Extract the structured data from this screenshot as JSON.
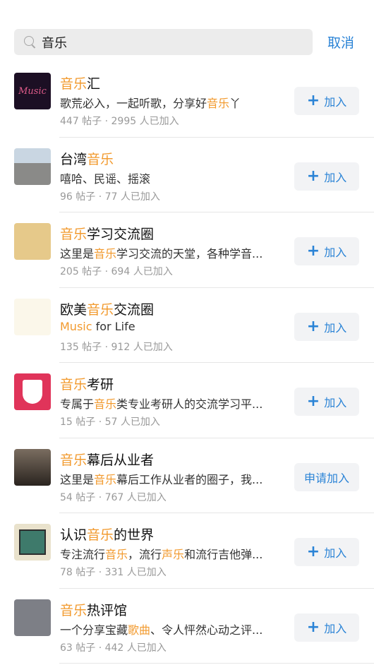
{
  "search": {
    "value": "音乐",
    "placeholder": ""
  },
  "cancel_label": "取消",
  "join_plus": "+",
  "items": [
    {
      "title": [
        [
          "音乐",
          true
        ],
        [
          "汇",
          false
        ]
      ],
      "desc": [
        [
          "歌荒必入，一起听歌，分享好",
          false
        ],
        [
          "音乐",
          true
        ],
        [
          "丫",
          false
        ]
      ],
      "meta": "447 帖子 · 2995 人已加入",
      "button": "加入",
      "thumb_text": "Music"
    },
    {
      "title": [
        [
          "台湾",
          false
        ],
        [
          "音乐",
          true
        ]
      ],
      "desc": [
        [
          "嘻哈、民谣、摇滚",
          false
        ]
      ],
      "meta": "96 帖子 · 77 人已加入",
      "button": "加入"
    },
    {
      "title": [
        [
          "音乐",
          true
        ],
        [
          "学习交流圈",
          false
        ]
      ],
      "desc": [
        [
          "这里是",
          false
        ],
        [
          "音乐",
          true
        ],
        [
          "学习交流的天堂，各种学音...",
          false
        ]
      ],
      "meta": "205 帖子 · 694 人已加入",
      "button": "加入"
    },
    {
      "title": [
        [
          "欧美",
          false
        ],
        [
          "音乐",
          true
        ],
        [
          "交流圈",
          false
        ]
      ],
      "desc": [
        [
          "Music",
          true
        ],
        [
          " for Life",
          false
        ]
      ],
      "meta": "135 帖子 · 912 人已加入",
      "button": "加入",
      "thumb_text": "Music"
    },
    {
      "title": [
        [
          "音乐",
          true
        ],
        [
          "考研",
          false
        ]
      ],
      "desc": [
        [
          "专属于",
          false
        ],
        [
          "音乐",
          true
        ],
        [
          "类专业考研人的交流学习平...",
          false
        ]
      ],
      "meta": "15 帖子 · 57 人已加入",
      "button": "加入"
    },
    {
      "title": [
        [
          "音乐",
          true
        ],
        [
          "幕后从业者",
          false
        ]
      ],
      "desc": [
        [
          "这里是",
          false
        ],
        [
          "音乐",
          true
        ],
        [
          "幕后工作从业者的圈子，我...",
          false
        ]
      ],
      "meta": "54 帖子 · 767 人已加入",
      "button": "申请加入",
      "no_plus": true
    },
    {
      "title": [
        [
          "认识",
          false
        ],
        [
          "音乐",
          true
        ],
        [
          "的世界",
          false
        ]
      ],
      "desc": [
        [
          "专注流行",
          false
        ],
        [
          "音乐",
          true
        ],
        [
          "，流行",
          false
        ],
        [
          "声乐",
          true
        ],
        [
          "和流行吉他弹...",
          false
        ]
      ],
      "meta": "78 帖子 · 331 人已加入",
      "button": "加入"
    },
    {
      "title": [
        [
          "音乐",
          true
        ],
        [
          "热评馆",
          false
        ]
      ],
      "desc": [
        [
          "一个分享宝藏",
          false
        ],
        [
          "歌曲",
          true
        ],
        [
          "、令人怦然心动之评...",
          false
        ]
      ],
      "meta": "63 帖子 · 442 人已加入",
      "button": "加入"
    }
  ],
  "colors": {
    "accent": "#2a83d6",
    "highlight": "#f29a2e"
  }
}
